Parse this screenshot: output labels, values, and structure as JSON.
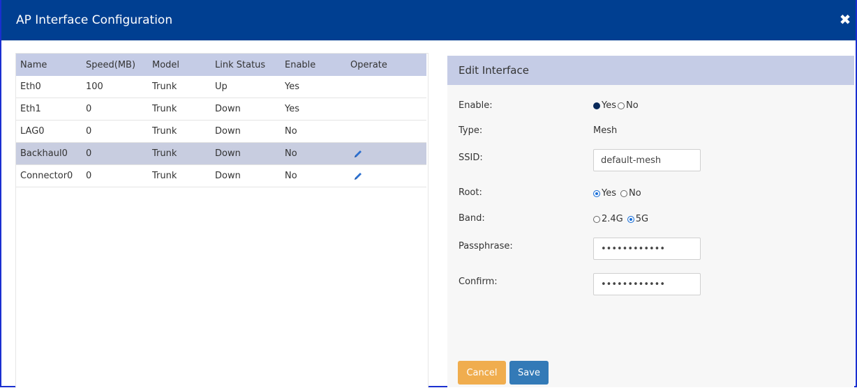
{
  "dialog": {
    "title": "AP Interface Configuration",
    "close_label": "✖"
  },
  "table": {
    "headers": [
      "Name",
      "Speed(MB)",
      "Model",
      "Link Status",
      "Enable",
      "Operate"
    ],
    "rows": [
      {
        "name": "Eth0",
        "speed": "100",
        "model": "Trunk",
        "link": "Up",
        "enable": "Yes",
        "editable": false
      },
      {
        "name": "Eth1",
        "speed": "0",
        "model": "Trunk",
        "link": "Down",
        "enable": "Yes",
        "editable": false
      },
      {
        "name": "LAG0",
        "speed": "0",
        "model": "Trunk",
        "link": "Down",
        "enable": "No",
        "editable": false
      },
      {
        "name": "Backhaul0",
        "speed": "0",
        "model": "Trunk",
        "link": "Down",
        "enable": "No",
        "editable": true,
        "selected": true
      },
      {
        "name": "Connector0",
        "speed": "0",
        "model": "Trunk",
        "link": "Down",
        "enable": "No",
        "editable": true
      }
    ]
  },
  "edit": {
    "header": "Edit Interface",
    "enable": {
      "label": "Enable:",
      "options": [
        "Yes",
        "No"
      ],
      "selected": "Yes"
    },
    "type": {
      "label": "Type:",
      "value": "Mesh"
    },
    "ssid": {
      "label": "SSID:",
      "value": "default-mesh"
    },
    "root": {
      "label": "Root:",
      "options": [
        "Yes",
        "No"
      ],
      "selected": "Yes"
    },
    "band": {
      "label": "Band:",
      "options": [
        "2.4G",
        "5G"
      ],
      "selected": "5G"
    },
    "passphrase": {
      "label": "Passphrase:",
      "value": "••••••••••••"
    },
    "confirm": {
      "label": "Confirm:",
      "value": "••••••••••••"
    },
    "cancel_label": "Cancel",
    "save_label": "Save"
  },
  "colors": {
    "titlebar": "#003f91",
    "header_bg": "#c5cce6",
    "cancel": "#f0ad4e",
    "save": "#337ab7",
    "edit_icon": "#2b6fcf"
  },
  "icons": {
    "close": "close-icon",
    "edit": "pencil-icon"
  }
}
